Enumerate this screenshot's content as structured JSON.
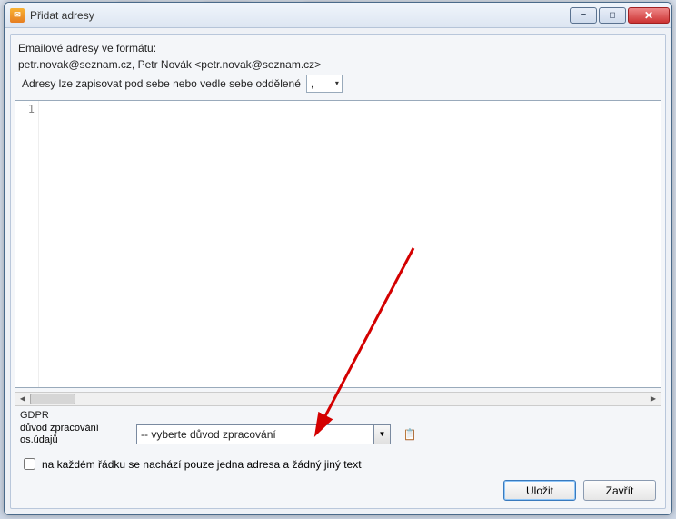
{
  "window": {
    "title": "Přidat adresy"
  },
  "help": {
    "line1": "Emailové adresy ve formátu:",
    "line2": "petr.novak@seznam.cz, Petr Novák <petr.novak@seznam.cz>",
    "line3": "Adresy lze zapisovat pod sebe nebo vedle sebe oddělené"
  },
  "separator": {
    "selected": ","
  },
  "editor": {
    "line_number": "1",
    "content": ""
  },
  "gdpr": {
    "legend": "GDPR",
    "label": "důvod zpracování os.údajů",
    "selected": "-- vyberte důvod zpracování"
  },
  "checkbox": {
    "label": "na každém řádku se nachází pouze jedna adresa a žádný jiný text",
    "checked": false
  },
  "buttons": {
    "save": "Uložit",
    "close": "Zavřít"
  }
}
